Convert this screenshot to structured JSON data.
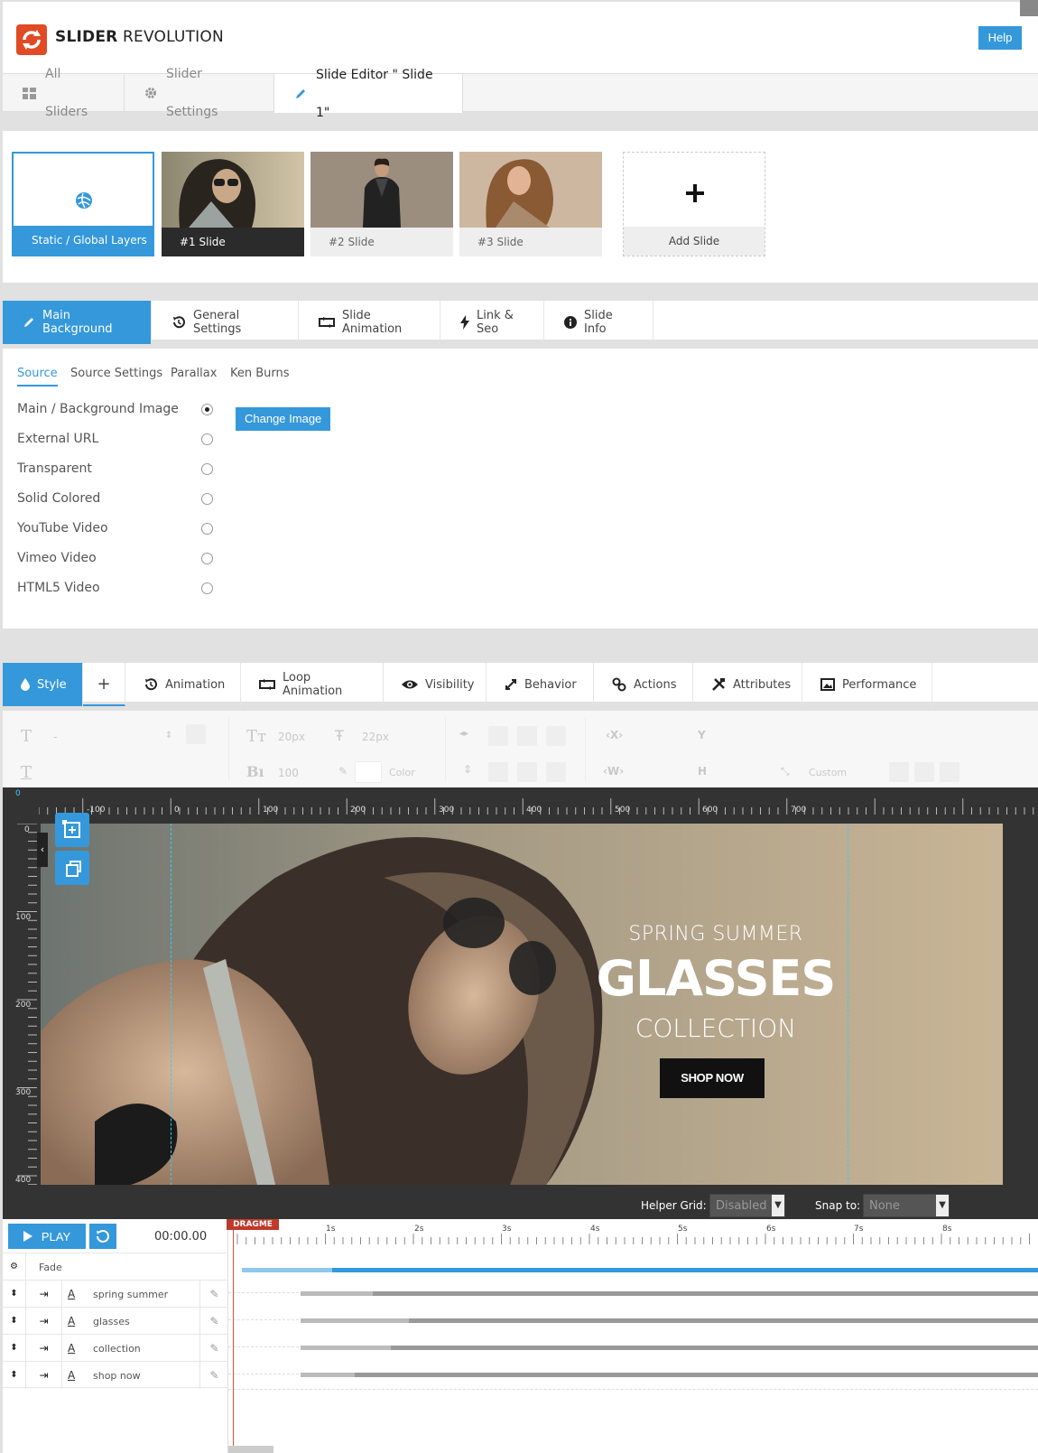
{
  "header": {
    "logo_bold": "SLIDER",
    "logo_light": "REVOLUTION",
    "help_label": "Help",
    "accent": "#3498db",
    "logo_color": "#e04b25"
  },
  "top_tabs": [
    {
      "label": "All Sliders",
      "icon": "grid-icon"
    },
    {
      "label": "Slider Settings",
      "icon": "gear-icon"
    },
    {
      "label": "Slide Editor \" Slide 1\"",
      "icon": "pencil-icon",
      "active": true
    }
  ],
  "slides": {
    "static_label": "Static / Global Layers",
    "items": [
      "#1 Slide",
      "#2 Slide",
      "#3 Slide"
    ],
    "add_label": "Add Slide"
  },
  "settings_tabs": [
    {
      "label": "Main Background",
      "icon": "pencil-icon",
      "active": true
    },
    {
      "label": "General Settings",
      "icon": "history-icon"
    },
    {
      "label": "Slide Animation",
      "icon": "loop-icon"
    },
    {
      "label": "Link & Seo",
      "icon": "bolt-icon"
    },
    {
      "label": "Slide Info",
      "icon": "info-icon"
    }
  ],
  "source": {
    "subtabs": [
      "Source",
      "Source Settings",
      "Parallax",
      "Ken Burns"
    ],
    "options": [
      {
        "label": "Main / Background Image",
        "checked": true
      },
      {
        "label": "External URL",
        "checked": false
      },
      {
        "label": "Transparent",
        "checked": false
      },
      {
        "label": "Solid Colored",
        "checked": false
      },
      {
        "label": "YouTube Video",
        "checked": false
      },
      {
        "label": "Vimeo Video",
        "checked": false
      },
      {
        "label": "HTML5 Video",
        "checked": false
      }
    ],
    "change_image_label": "Change Image"
  },
  "layer_tabs": [
    {
      "label": "Style",
      "icon": "drop-icon",
      "active": true
    },
    {
      "label": "+",
      "icon": "plus-icon"
    },
    {
      "label": "Animation",
      "icon": "history-icon"
    },
    {
      "label": "Loop Animation",
      "icon": "loop-icon"
    },
    {
      "label": "Visibility",
      "icon": "eye-icon"
    },
    {
      "label": "Behavior",
      "icon": "resize-icon"
    },
    {
      "label": "Actions",
      "icon": "link-icon"
    },
    {
      "label": "Attributes",
      "icon": "tools-icon"
    },
    {
      "label": "Performance",
      "icon": "image-icon"
    }
  ],
  "toolbar": {
    "font_size": "20px",
    "line_height": "22px",
    "font_weight": "100",
    "color_label": "Color",
    "x_label": "X",
    "y_label": "Y",
    "w_label": "W",
    "h_label": "H",
    "custom_label": "Custom",
    "dash": "-"
  },
  "stage": {
    "ruler_h": [
      "-100",
      "0",
      "100",
      "200",
      "300",
      "400",
      "500",
      "600",
      "700"
    ],
    "ruler_v": [
      "0",
      "100",
      "200",
      "300",
      "400"
    ],
    "ruler_origin": "0",
    "caption_spring": "SPRING SUMMER",
    "caption_glasses": "GLASSES",
    "caption_collection": "COLLECTION",
    "shop_label": "SHOP NOW",
    "helper_grid_label": "Helper Grid:",
    "helper_grid_value": "Disabled",
    "snap_label": "Snap to:",
    "snap_value": "None"
  },
  "timeline": {
    "play_label": "PLAY",
    "time": "00:00.00",
    "dragme": "DRAGME",
    "ticks": [
      "1s",
      "2s",
      "3s",
      "4s",
      "5s",
      "6s",
      "7s",
      "8s"
    ],
    "bg_row_label": "Fade",
    "layers": [
      "spring summer",
      "glasses",
      "collection",
      "shop now"
    ]
  }
}
